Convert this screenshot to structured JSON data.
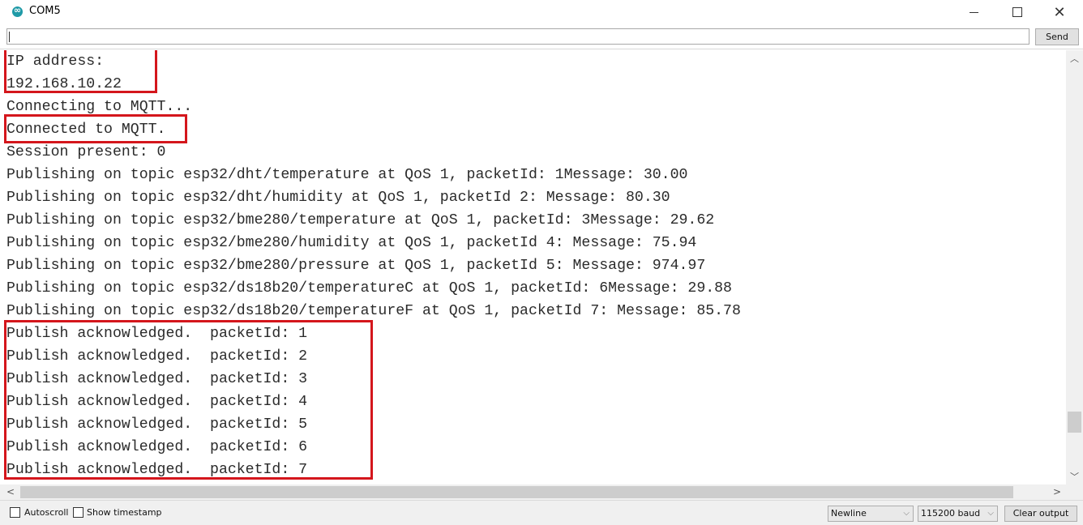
{
  "window": {
    "title": "COM5",
    "icon": "arduino-icon",
    "controls": {
      "minimize": "minimize-icon",
      "maximize": "maximize-icon",
      "close": "close-icon"
    }
  },
  "input": {
    "value": "",
    "placeholder": "",
    "send_label": "Send"
  },
  "output": {
    "lines": [
      "IP address:",
      "192.168.10.22",
      "Connecting to MQTT...",
      "Connected to MQTT.",
      "Session present: 0",
      "Publishing on topic esp32/dht/temperature at QoS 1, packetId: 1Message: 30.00",
      "Publishing on topic esp32/dht/humidity at QoS 1, packetId 2: Message: 80.30",
      "Publishing on topic esp32/bme280/temperature at QoS 1, packetId: 3Message: 29.62",
      "Publishing on topic esp32/bme280/humidity at QoS 1, packetId 4: Message: 75.94",
      "Publishing on topic esp32/bme280/pressure at QoS 1, packetId 5: Message: 974.97",
      "Publishing on topic esp32/ds18b20/temperatureC at QoS 1, packetId: 6Message: 29.88",
      "Publishing on topic esp32/ds18b20/temperatureF at QoS 1, packetId 7: Message: 85.78",
      "Publish acknowledged.  packetId: 1",
      "Publish acknowledged.  packetId: 2",
      "Publish acknowledged.  packetId: 3",
      "Publish acknowledged.  packetId: 4",
      "Publish acknowledged.  packetId: 5",
      "Publish acknowledged.  packetId: 6",
      "Publish acknowledged.  packetId: 7"
    ],
    "highlight_color": "#d4161c"
  },
  "scrollbars": {
    "vertical": {
      "up": "▲",
      "down": "▼"
    },
    "horizontal": {
      "left": "<",
      "right": ">"
    }
  },
  "footer": {
    "autoscroll_label": "Autoscroll",
    "autoscroll_checked": false,
    "timestamp_label": "Show timestamp",
    "timestamp_checked": false,
    "line_ending": "Newline",
    "baud_rate": "115200 baud",
    "clear_label": "Clear output"
  }
}
